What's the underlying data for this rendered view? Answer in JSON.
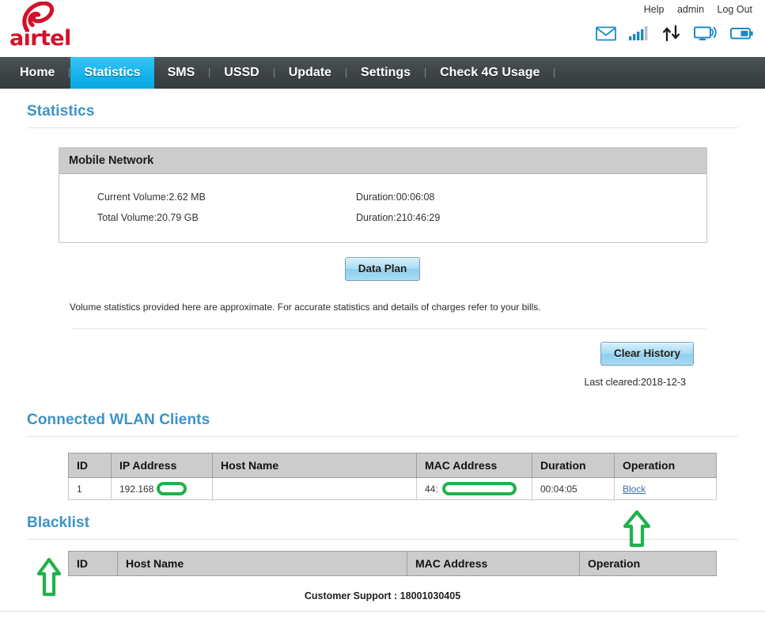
{
  "header": {
    "brand": "airtel",
    "account_links": [
      {
        "label": "Help",
        "name": "help-link"
      },
      {
        "label": "admin",
        "name": "account-name-link"
      },
      {
        "label": "Log Out",
        "name": "log-out-link"
      }
    ],
    "status_icons": [
      {
        "name": "mail-icon",
        "title": "Messages"
      },
      {
        "name": "signal-strength-icon",
        "title": "Signal",
        "bars_filled": 4,
        "bars_total": 5
      },
      {
        "name": "data-transfer-icon",
        "title": "Up/Down traffic"
      },
      {
        "name": "wifi-monitor-icon",
        "title": "WLAN"
      },
      {
        "name": "battery-icon",
        "title": "Battery"
      }
    ],
    "accent_color": "#3c93c7",
    "brand_color": "#d3122a",
    "active_tab_color": "#16b4ec"
  },
  "nav": {
    "items": [
      {
        "label": "Home",
        "active": false
      },
      {
        "label": "Statistics",
        "active": true
      },
      {
        "label": "SMS",
        "active": false
      },
      {
        "label": "USSD",
        "active": false
      },
      {
        "label": "Update",
        "active": false
      },
      {
        "label": "Settings",
        "active": false
      },
      {
        "label": "Check 4G Usage",
        "active": false
      }
    ]
  },
  "statistics": {
    "page_title": "Statistics",
    "panel": {
      "title": "Mobile Network",
      "rows": [
        {
          "left": "Current Volume:2.62 MB",
          "right": "Duration:00:06:08"
        },
        {
          "left": "Total Volume:20.79 GB",
          "right": "Duration:210:46:29"
        }
      ]
    },
    "data_plan_button": "Data Plan",
    "note": "Volume statistics provided here are approximate. For accurate statistics and details of charges refer to your bills.",
    "clear_history_button": "Clear History",
    "last_cleared": "Last cleared:2018-12-3"
  },
  "wlan_clients": {
    "title": "Connected WLAN Clients",
    "columns": [
      "ID",
      "IP Address",
      "Host Name",
      "MAC Address",
      "Duration",
      "Operation"
    ],
    "rows": [
      {
        "id": "1",
        "ip_address": "192.168",
        "ip_redacted": true,
        "host_name": "",
        "mac_address": "44:",
        "mac_redacted": true,
        "duration": "00:04:05",
        "operation": "Block"
      }
    ]
  },
  "blacklist": {
    "title": "Blacklist",
    "columns": [
      "ID",
      "Host Name",
      "MAC Address",
      "Operation"
    ],
    "rows": []
  },
  "annotations": {
    "color": "#22b14c",
    "arrows": [
      {
        "name": "annotation-arrow-block",
        "points_to": "Block link"
      },
      {
        "name": "annotation-arrow-blacklist",
        "points_to": "Blacklist heading"
      }
    ]
  },
  "footer": {
    "support": "Customer Support : 18001030405"
  }
}
